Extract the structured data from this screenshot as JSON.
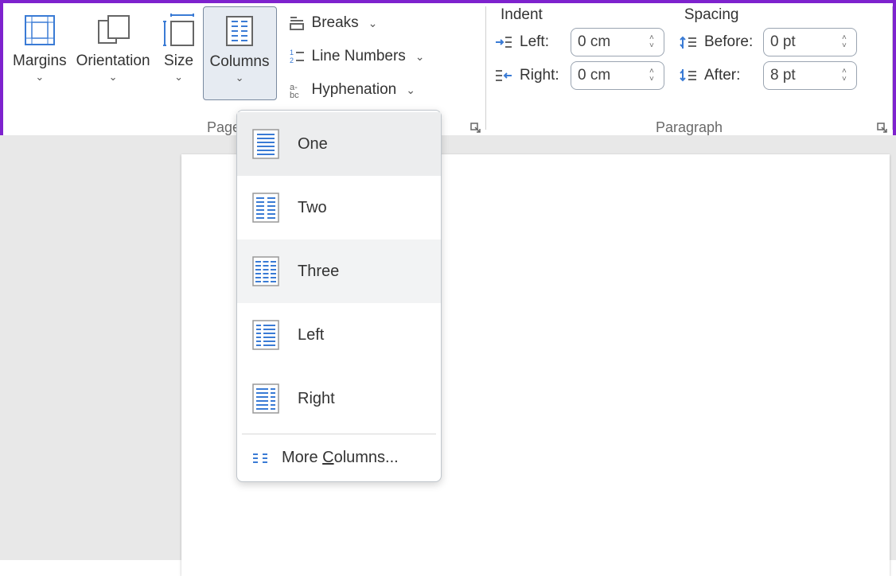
{
  "ribbon": {
    "margins": "Margins",
    "orientation": "Orientation",
    "size": "Size",
    "columns": "Columns",
    "breaks": "Breaks",
    "line_numbers": "Line Numbers",
    "hyphenation": "Hyphenation",
    "page_setup": "Page Setup",
    "indent_heading": "Indent",
    "spacing_heading": "Spacing",
    "left": "Left:",
    "right": "Right:",
    "before": "Before:",
    "after": "After:",
    "left_val": "0 cm",
    "right_val": "0 cm",
    "before_val": "0 pt",
    "after_val": "8 pt",
    "paragraph": "Paragraph"
  },
  "columns_menu": {
    "one": "One",
    "two": "Two",
    "three": "Three",
    "left": "Left",
    "right": "Right",
    "more_prefix": "More ",
    "more_u": "C",
    "more_suffix": "olumns..."
  }
}
